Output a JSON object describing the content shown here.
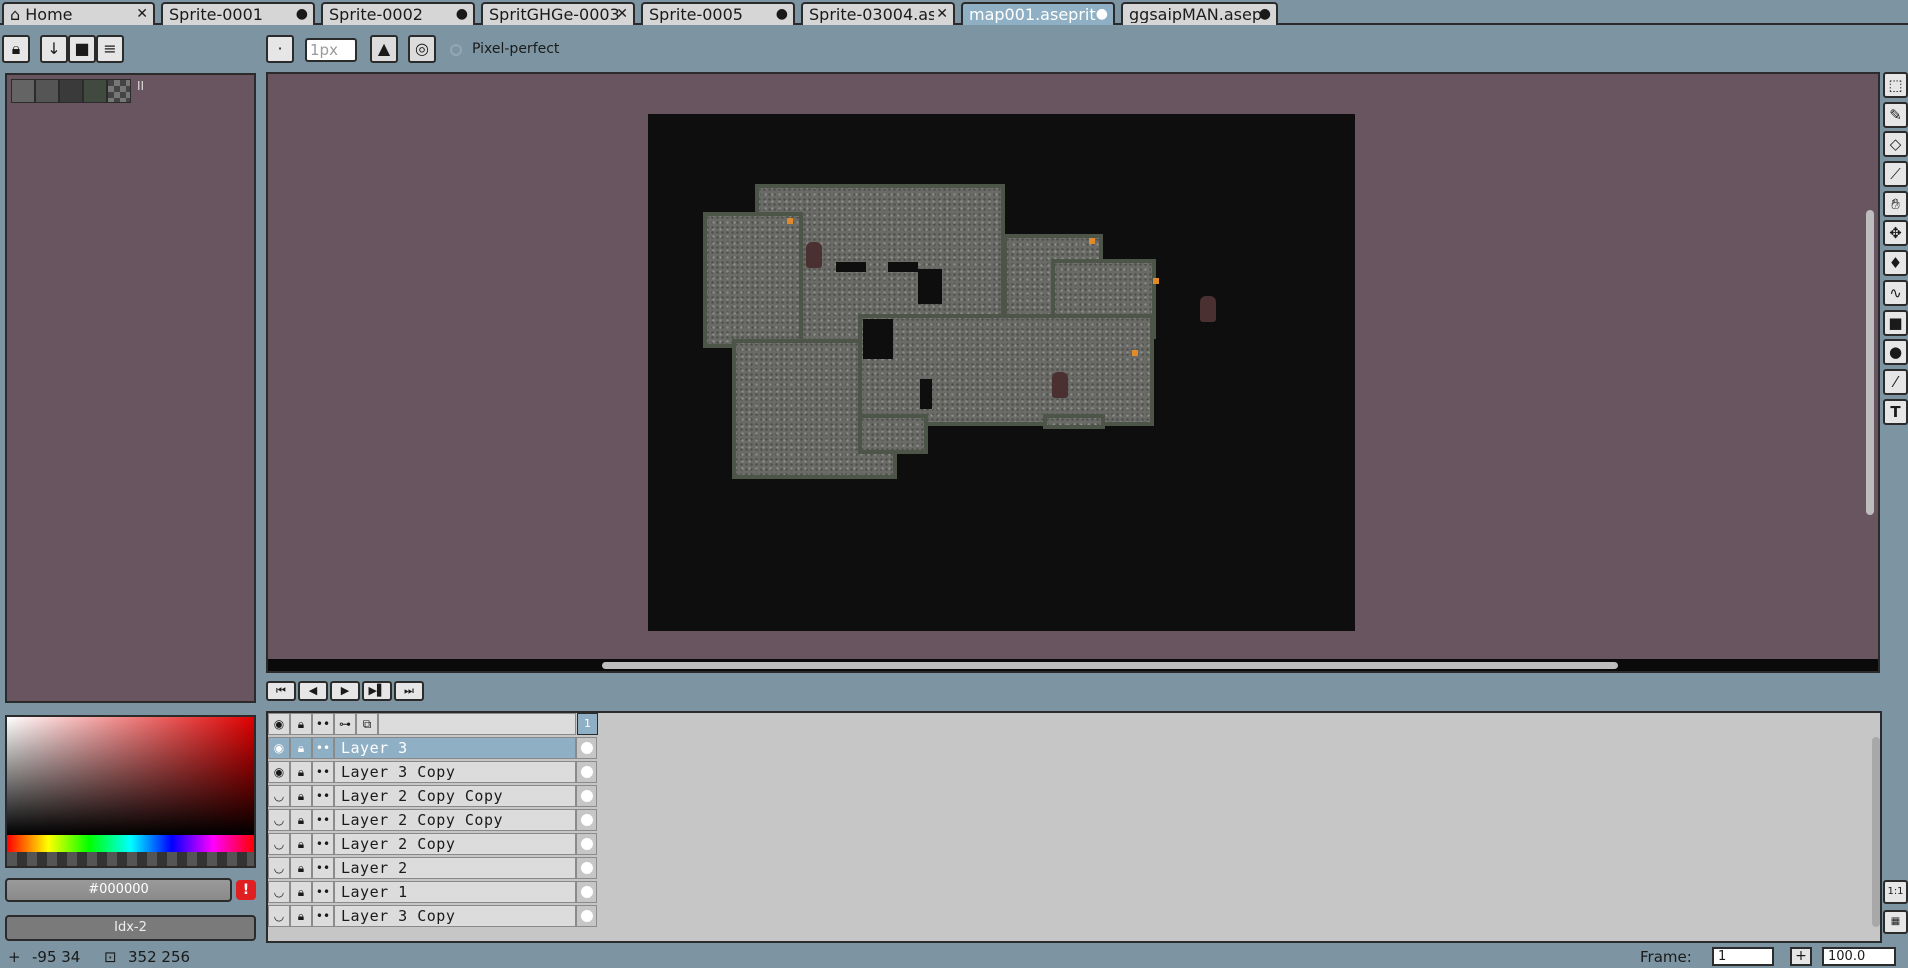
{
  "tabs": [
    {
      "label": "Home",
      "icon": "home-icon",
      "end": "✕",
      "active": false
    },
    {
      "label": "Sprite-0001",
      "end": "●",
      "active": false
    },
    {
      "label": "Sprite-0002",
      "end": "●",
      "active": false
    },
    {
      "label": "SpritGHGe-0003",
      "end": "✕",
      "active": false
    },
    {
      "label": "Sprite-0005",
      "end": "●",
      "active": false
    },
    {
      "label": "Sprite-03004.as",
      "end": "✕",
      "active": false
    },
    {
      "label": "map001.asepriti",
      "end": "●",
      "active": true
    },
    {
      "label": "ggsaipMAN.asep",
      "end": "●",
      "active": false
    }
  ],
  "toolbar": {
    "brush_size": "1px",
    "pixel_perfect_label": "Pixel-perfect",
    "icons": [
      "lock-icon",
      "arrow-down-icon",
      "square-icon",
      "menu-icon",
      "brush-dot-icon",
      "ink-bucket-icon",
      "symmetry-icon"
    ]
  },
  "palette": {
    "swatches": [
      "#646464",
      "#555555",
      "#3a3a3a",
      "#404a3e",
      "checker"
    ],
    "extra": "II"
  },
  "color": {
    "value": "#000000",
    "index": "Idx-2",
    "warning": "!"
  },
  "tools": [
    "rectangular-marquee-icon",
    "pencil-icon",
    "eraser-icon",
    "eyedropper-icon",
    "hand-icon",
    "move-icon",
    "paint-bucket-icon",
    "curve-icon",
    "rectangle-icon",
    "ellipse-icon",
    "spray-icon",
    "text-icon"
  ],
  "animation_buttons": [
    "⏮",
    "◀",
    "▶",
    "▶▌",
    "⏭"
  ],
  "layers_header": {
    "frame_number": "1"
  },
  "layers": [
    {
      "name": "Layer 3",
      "visible": true,
      "selected": true
    },
    {
      "name": "Layer 3 Copy",
      "visible": true,
      "selected": false
    },
    {
      "name": "Layer 2 Copy Copy",
      "visible": false,
      "selected": false
    },
    {
      "name": "Layer 2 Copy Copy",
      "visible": false,
      "selected": false
    },
    {
      "name": "Layer 2 Copy",
      "visible": false,
      "selected": false
    },
    {
      "name": "Layer 2",
      "visible": false,
      "selected": false
    },
    {
      "name": "Layer 1",
      "visible": false,
      "selected": false
    },
    {
      "name": "Layer 3 Copy",
      "visible": false,
      "selected": false
    }
  ],
  "timeline_side": [
    "1:1",
    "▦"
  ],
  "status": {
    "cursor_position": "-95 34",
    "sprite_size": "352 256",
    "frame_label": "Frame:",
    "frame_value": "1",
    "plus": "+",
    "zoom": "100.0"
  }
}
